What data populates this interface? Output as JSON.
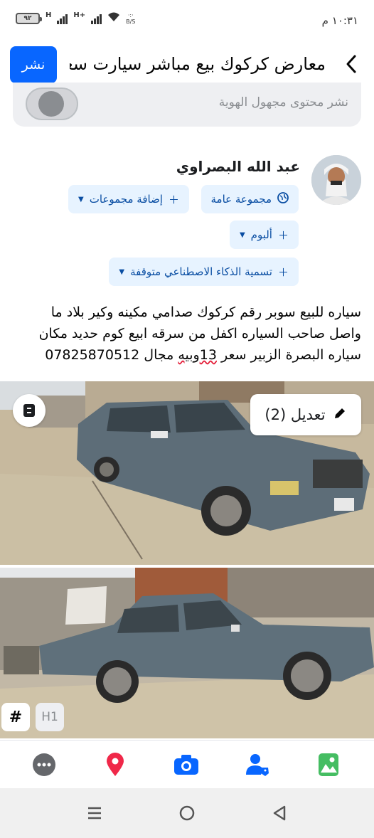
{
  "status_bar": {
    "time": "١٠:٣١ م",
    "battery": "٩٢",
    "signal1": "H",
    "signal2": "H+",
    "speed": "B/S"
  },
  "header": {
    "title": "معارض كركوك بيع مباشر سيارت سعر...",
    "publish_label": "نشر"
  },
  "anonymous": {
    "label": "نشر محتوى مجهول الهوية",
    "enabled": false
  },
  "user": {
    "name": "عبد الله البصراوي"
  },
  "chips": {
    "audience": "مجموعة عامة",
    "add_groups": "إضافة مجموعات",
    "album": "ألبوم",
    "ai_label": "تسمية الذكاء الاصطناعي متوقفة"
  },
  "post": {
    "line1": "سياره للبيع سوبر رقم كركوك صدامي مكينه وكير بلاد ما",
    "line2": "واصل صاحب السياره اكفل من سرقه ابيع كوم حديد مكان",
    "line3_a": "سياره البصرة الزبير سعر ",
    "line3_b": "13وبيه",
    "line3_c": " مجال 07825870512"
  },
  "photo_actions": {
    "edit_label": "تعديل (2)"
  },
  "format": {
    "hash": "#",
    "h1": "H1"
  },
  "colors": {
    "accent": "#0866ff",
    "chip_bg": "#e7f3ff",
    "chip_text": "#0a4ea3",
    "location": "#f02849",
    "photo": "#45bd62"
  },
  "toolbar_icons": [
    "more-icon",
    "location-pin-icon",
    "camera-icon",
    "tag-people-icon",
    "photo-icon"
  ],
  "nav_icons": [
    "recents-icon",
    "home-icon",
    "back-icon"
  ]
}
